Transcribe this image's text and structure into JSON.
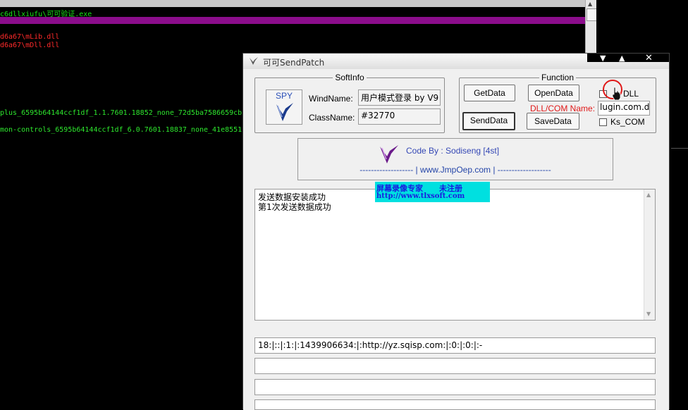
{
  "console": {
    "path_line": "c6dllxiufu\\可可验证.exe",
    "lines_red": [
      "d6a67\\mLib.dll",
      "d6a67\\mDll.dll"
    ],
    "lines_green": [
      "plus_6595b64144ccf1df_1.1.7601.18852_none_72d5ba7586659cb",
      "mon-controls_6595b64144ccf1df_6.0.7601.18837_none_41e8551"
    ]
  },
  "window": {
    "title": "可可SendPatch",
    "btn_minimize": "▼",
    "btn_maximize": "▲",
    "btn_close": "✕"
  },
  "softinfo": {
    "legend": "SoftInfo",
    "spy_label": "SPY",
    "wind_label": "WindName:",
    "wind_value": "用户模式登录 by V9",
    "class_label": "ClassName:",
    "class_value": "#32770"
  },
  "function": {
    "legend": "Function",
    "getdata": "GetData",
    "opendata": "OpenData",
    "senddata": "SendData",
    "savedata": "SaveData",
    "dll_checkbox": "DLL",
    "dllcom_label": "DLL/COM Name:",
    "dllcom_value": "lugin.com.dll",
    "kscom_checkbox": "Ks_COM",
    "dll_checked": false,
    "kscom_checked": false
  },
  "code": {
    "by": "Code By : Sodiseng  [4st]",
    "url_line": "------------------- | www.JmpOep.com | -------------------"
  },
  "watermark": {
    "line1": "屏幕录像专家      未注册",
    "line2": "http://www.tlxsoft.com"
  },
  "log": {
    "lines": [
      "发送数据安装成功",
      "第1次发送数据成功"
    ]
  },
  "fields": {
    "data1": "18:|::|:1:|:1439906634:|:http://yz.sqisp.com:|:0:|:0:|:-",
    "data2": "",
    "data3": "",
    "data4": ""
  },
  "colors": {
    "console_green": "#2ee82e",
    "console_red": "#ff2a2a",
    "console_selection": "#8b0d8b",
    "dllcom_label": "#e01818",
    "code_text": "#3548b5",
    "watermark_bg": "#00e0e0"
  }
}
